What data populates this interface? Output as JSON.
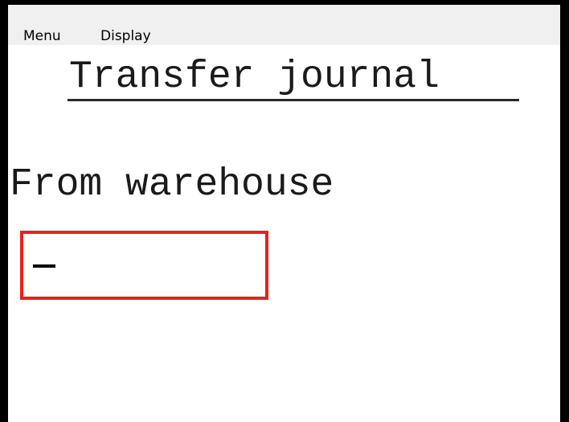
{
  "menubar": {
    "items": [
      {
        "label": "Menu"
      },
      {
        "label": "Display"
      }
    ]
  },
  "page": {
    "title": "Transfer journal"
  },
  "form": {
    "from_warehouse_label": "From warehouse",
    "from_warehouse_value": ""
  },
  "colors": {
    "focus_border": "#e8211d",
    "window_border": "#000000",
    "menubar_background": "#f0f0f0"
  }
}
